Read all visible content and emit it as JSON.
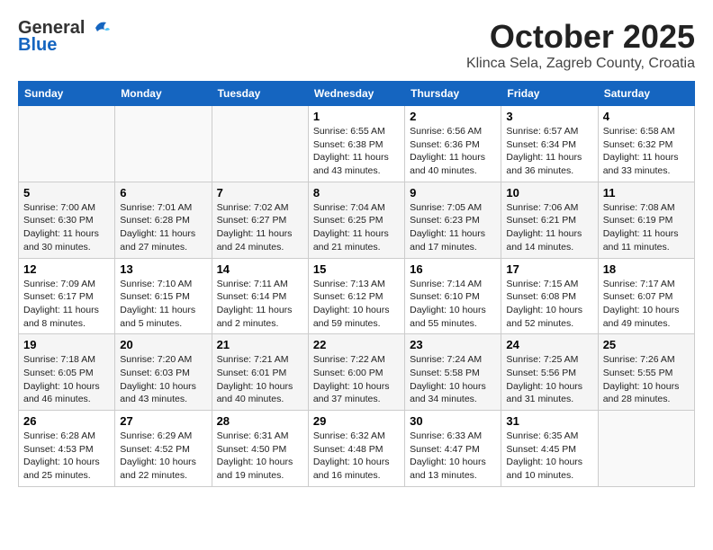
{
  "header": {
    "logo_general": "General",
    "logo_blue": "Blue",
    "month_title": "October 2025",
    "subtitle": "Klinca Sela, Zagreb County, Croatia"
  },
  "days_of_week": [
    "Sunday",
    "Monday",
    "Tuesday",
    "Wednesday",
    "Thursday",
    "Friday",
    "Saturday"
  ],
  "weeks": [
    [
      {
        "day": "",
        "info": ""
      },
      {
        "day": "",
        "info": ""
      },
      {
        "day": "",
        "info": ""
      },
      {
        "day": "1",
        "info": "Sunrise: 6:55 AM\nSunset: 6:38 PM\nDaylight: 11 hours\nand 43 minutes."
      },
      {
        "day": "2",
        "info": "Sunrise: 6:56 AM\nSunset: 6:36 PM\nDaylight: 11 hours\nand 40 minutes."
      },
      {
        "day": "3",
        "info": "Sunrise: 6:57 AM\nSunset: 6:34 PM\nDaylight: 11 hours\nand 36 minutes."
      },
      {
        "day": "4",
        "info": "Sunrise: 6:58 AM\nSunset: 6:32 PM\nDaylight: 11 hours\nand 33 minutes."
      }
    ],
    [
      {
        "day": "5",
        "info": "Sunrise: 7:00 AM\nSunset: 6:30 PM\nDaylight: 11 hours\nand 30 minutes."
      },
      {
        "day": "6",
        "info": "Sunrise: 7:01 AM\nSunset: 6:28 PM\nDaylight: 11 hours\nand 27 minutes."
      },
      {
        "day": "7",
        "info": "Sunrise: 7:02 AM\nSunset: 6:27 PM\nDaylight: 11 hours\nand 24 minutes."
      },
      {
        "day": "8",
        "info": "Sunrise: 7:04 AM\nSunset: 6:25 PM\nDaylight: 11 hours\nand 21 minutes."
      },
      {
        "day": "9",
        "info": "Sunrise: 7:05 AM\nSunset: 6:23 PM\nDaylight: 11 hours\nand 17 minutes."
      },
      {
        "day": "10",
        "info": "Sunrise: 7:06 AM\nSunset: 6:21 PM\nDaylight: 11 hours\nand 14 minutes."
      },
      {
        "day": "11",
        "info": "Sunrise: 7:08 AM\nSunset: 6:19 PM\nDaylight: 11 hours\nand 11 minutes."
      }
    ],
    [
      {
        "day": "12",
        "info": "Sunrise: 7:09 AM\nSunset: 6:17 PM\nDaylight: 11 hours\nand 8 minutes."
      },
      {
        "day": "13",
        "info": "Sunrise: 7:10 AM\nSunset: 6:15 PM\nDaylight: 11 hours\nand 5 minutes."
      },
      {
        "day": "14",
        "info": "Sunrise: 7:11 AM\nSunset: 6:14 PM\nDaylight: 11 hours\nand 2 minutes."
      },
      {
        "day": "15",
        "info": "Sunrise: 7:13 AM\nSunset: 6:12 PM\nDaylight: 10 hours\nand 59 minutes."
      },
      {
        "day": "16",
        "info": "Sunrise: 7:14 AM\nSunset: 6:10 PM\nDaylight: 10 hours\nand 55 minutes."
      },
      {
        "day": "17",
        "info": "Sunrise: 7:15 AM\nSunset: 6:08 PM\nDaylight: 10 hours\nand 52 minutes."
      },
      {
        "day": "18",
        "info": "Sunrise: 7:17 AM\nSunset: 6:07 PM\nDaylight: 10 hours\nand 49 minutes."
      }
    ],
    [
      {
        "day": "19",
        "info": "Sunrise: 7:18 AM\nSunset: 6:05 PM\nDaylight: 10 hours\nand 46 minutes."
      },
      {
        "day": "20",
        "info": "Sunrise: 7:20 AM\nSunset: 6:03 PM\nDaylight: 10 hours\nand 43 minutes."
      },
      {
        "day": "21",
        "info": "Sunrise: 7:21 AM\nSunset: 6:01 PM\nDaylight: 10 hours\nand 40 minutes."
      },
      {
        "day": "22",
        "info": "Sunrise: 7:22 AM\nSunset: 6:00 PM\nDaylight: 10 hours\nand 37 minutes."
      },
      {
        "day": "23",
        "info": "Sunrise: 7:24 AM\nSunset: 5:58 PM\nDaylight: 10 hours\nand 34 minutes."
      },
      {
        "day": "24",
        "info": "Sunrise: 7:25 AM\nSunset: 5:56 PM\nDaylight: 10 hours\nand 31 minutes."
      },
      {
        "day": "25",
        "info": "Sunrise: 7:26 AM\nSunset: 5:55 PM\nDaylight: 10 hours\nand 28 minutes."
      }
    ],
    [
      {
        "day": "26",
        "info": "Sunrise: 6:28 AM\nSunset: 4:53 PM\nDaylight: 10 hours\nand 25 minutes."
      },
      {
        "day": "27",
        "info": "Sunrise: 6:29 AM\nSunset: 4:52 PM\nDaylight: 10 hours\nand 22 minutes."
      },
      {
        "day": "28",
        "info": "Sunrise: 6:31 AM\nSunset: 4:50 PM\nDaylight: 10 hours\nand 19 minutes."
      },
      {
        "day": "29",
        "info": "Sunrise: 6:32 AM\nSunset: 4:48 PM\nDaylight: 10 hours\nand 16 minutes."
      },
      {
        "day": "30",
        "info": "Sunrise: 6:33 AM\nSunset: 4:47 PM\nDaylight: 10 hours\nand 13 minutes."
      },
      {
        "day": "31",
        "info": "Sunrise: 6:35 AM\nSunset: 4:45 PM\nDaylight: 10 hours\nand 10 minutes."
      },
      {
        "day": "",
        "info": ""
      }
    ]
  ]
}
